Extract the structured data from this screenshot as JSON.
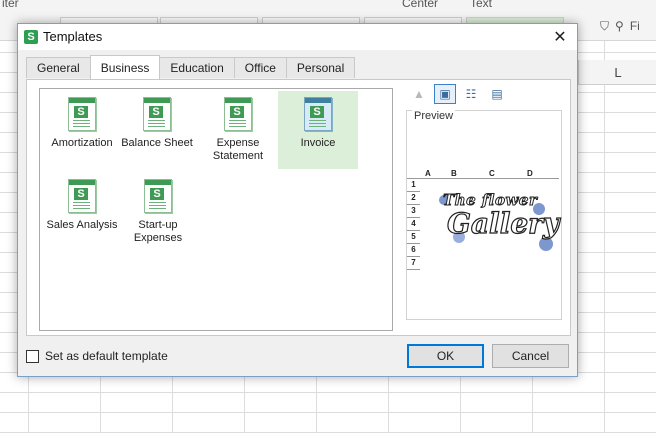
{
  "background": {
    "top_text_1": "iter",
    "top_text_2": "Center",
    "top_text_3": "Text",
    "column_label": "L",
    "search_prefix": "Fi"
  },
  "dialog": {
    "title": "Templates",
    "app_icon_letter": "S",
    "close_glyph": "✕"
  },
  "tabs": [
    {
      "label": "General"
    },
    {
      "label": "Business"
    },
    {
      "label": "Education"
    },
    {
      "label": "Office"
    },
    {
      "label": "Personal"
    }
  ],
  "active_tab": "Business",
  "templates": [
    {
      "label": "Amortization"
    },
    {
      "label": "Balance Sheet"
    },
    {
      "label": "Expense Statement"
    },
    {
      "label": "Invoice"
    },
    {
      "label": "Sales Analysis"
    },
    {
      "label": "Start-up Expenses"
    }
  ],
  "selected_template": "Invoice",
  "preview": {
    "label": "Preview",
    "columns": [
      "A",
      "B",
      "C",
      "D"
    ],
    "rows": [
      "1",
      "2",
      "3",
      "4",
      "5",
      "6",
      "7"
    ],
    "logo_line_1": "The flower",
    "logo_line_2": "Gallery"
  },
  "view_toolbar": [
    {
      "icon": "folder-up-icon"
    },
    {
      "icon": "large-icons-view-icon"
    },
    {
      "icon": "list-view-icon"
    },
    {
      "icon": "details-view-icon"
    }
  ],
  "footer": {
    "default_checkbox_label": "Set as default template",
    "ok_label": "OK",
    "cancel_label": "Cancel"
  },
  "colors": {
    "accent": "#0078d7",
    "selection": "#dcefd8",
    "icon_green": "#3e9a55"
  }
}
